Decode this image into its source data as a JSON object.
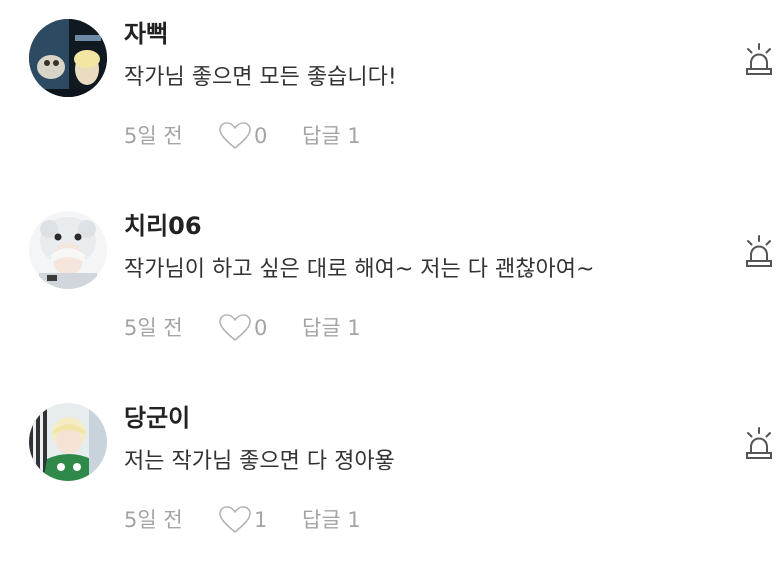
{
  "colors": {
    "text_primary": "#222222",
    "text_body": "#333333",
    "text_meta": "#a4a4a4",
    "icon_stroke": "#555555"
  },
  "comments": [
    {
      "author": "자뻑",
      "text": "작가님 좋으면 모든 좋습니다!",
      "time": "5일 전",
      "likes": "0",
      "reply_label": "답글 1",
      "avatar": "avatar-photo",
      "like_icon": "heart-outline-icon",
      "report_icon": "siren-icon"
    },
    {
      "author": "치리06",
      "text": "작가님이 하고 싶은 대로 해여~ 저는 다 괜찮아여~",
      "time": "5일 전",
      "likes": "0",
      "reply_label": "답글 1",
      "avatar": "avatar-photo",
      "like_icon": "heart-outline-icon",
      "report_icon": "siren-icon"
    },
    {
      "author": "당군이",
      "text": "저는 작가님 좋으면 다 졍아욯",
      "time": "5일 전",
      "likes": "1",
      "reply_label": "답글 1",
      "avatar": "avatar-photo",
      "like_icon": "heart-outline-icon",
      "report_icon": "siren-icon"
    }
  ]
}
